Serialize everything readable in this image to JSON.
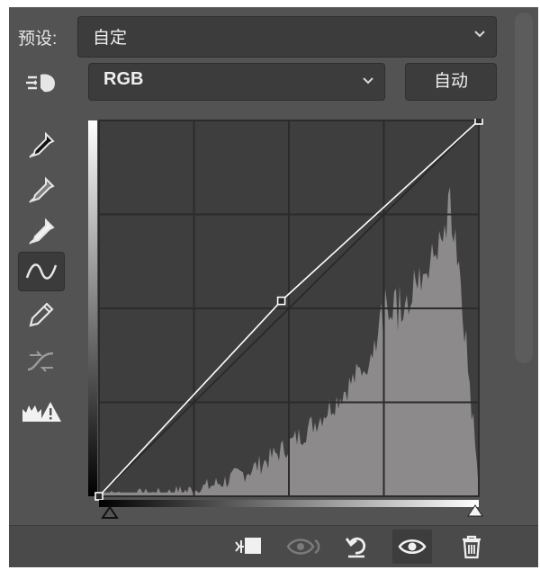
{
  "preset": {
    "label": "预设:",
    "value": "自定"
  },
  "channel": {
    "value": "RGB",
    "auto_label": "自动"
  },
  "colors": {
    "panel": "#535353",
    "field": "#3c3c3c",
    "histogram": "#8c8a8b",
    "graph_bg": "#3e3e3e",
    "curve": "#ffffff"
  },
  "tools": [
    {
      "name": "on-image-adjust-icon",
      "active": false
    },
    {
      "name": "black-point-eyedropper-icon",
      "active": false
    },
    {
      "name": "gray-point-eyedropper-icon",
      "active": false
    },
    {
      "name": "white-point-eyedropper-icon",
      "active": false
    },
    {
      "name": "curve-edit-points-icon",
      "active": true
    },
    {
      "name": "pencil-draw-icon",
      "active": false
    },
    {
      "name": "smooth-curve-icon",
      "active": false
    },
    {
      "name": "clipping-warning-icon",
      "active": false
    }
  ],
  "curve": {
    "points": [
      [
        0,
        0
      ],
      [
        0.48,
        0.52
      ],
      [
        1,
        1
      ]
    ]
  },
  "bottom_bar": [
    {
      "name": "clip-to-layer-icon",
      "active": false
    },
    {
      "name": "view-previous-state-icon",
      "active": false
    },
    {
      "name": "reset-icon",
      "active": false
    },
    {
      "name": "toggle-visibility-icon",
      "active": true
    },
    {
      "name": "delete-icon",
      "active": false
    }
  ]
}
